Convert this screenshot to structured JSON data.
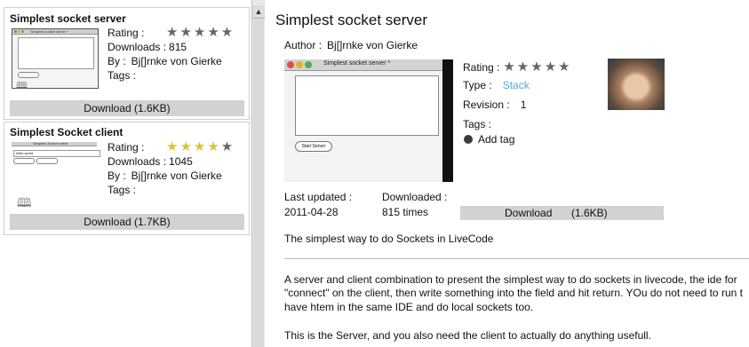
{
  "left_list": {
    "items": [
      {
        "title": "Simplest socket server",
        "rating_label": "Rating :",
        "rating_stars": "★★★★★",
        "rating_value": 0,
        "downloads_label": "Downloads :",
        "downloads": "815",
        "by_label": "By :",
        "author": "Bj[]rnke von Gierke",
        "tags_label": "Tags :",
        "download_button": "Download (1.6KB)",
        "thumb_title": "Simplest socket server *"
      },
      {
        "title": "Simplest Socket client",
        "rating_label": "Rating :",
        "rating_stars_on": "★★★★",
        "rating_stars_off": "★",
        "rating_value": 4,
        "downloads_label": "Downloads :",
        "downloads": "1045",
        "by_label": "By :",
        "author": "Bj[]rnke von Gierke",
        "tags_label": "Tags :",
        "download_button": "Download (1.7KB)",
        "thumb_title": "Simplest Socket client"
      }
    ]
  },
  "detail": {
    "title": "Simplest socket server",
    "author_label": "Author :",
    "author": "Bj[]rnke von Gierke",
    "screenshot_caption": "Simplest socket server *",
    "screenshot_button": "Start Server",
    "rating_label": "Rating :",
    "rating_stars": "★★★★★",
    "rating_value": 0,
    "type_label": "Type :",
    "type_value": "Stack",
    "revision_label": "Revision :",
    "revision_value": "1",
    "tags_label": "Tags :",
    "add_tag": "Add tag",
    "last_updated_label": "Last updated :",
    "last_updated": "2011-04-28",
    "downloaded_label": "Downloaded :",
    "downloaded": "815 times",
    "download_label": "Download",
    "download_size": "(1.6KB)",
    "summary": "The simplest way to do Sockets in LiveCode",
    "desc_line1": "A server and client combination to present the simplest way to do sockets in livecode, the ide for",
    "desc_line2": "\"connect\" on the client, then write something into the field and hit return. YOu do not need to run t",
    "desc_line3": "have htem in the same IDE and do local sockets too.",
    "desc_line4": "This is the Server, and you also need the client to actually do anything usefull."
  },
  "icons": {
    "scroll_up": "up-arrow-icon",
    "book": "book-icon",
    "add_tag": "add-circle-icon"
  },
  "colors": {
    "star_on": "#d9c338",
    "star_off": "#666666",
    "link": "#56a8d8",
    "button_bg": "#d2d2d2"
  }
}
